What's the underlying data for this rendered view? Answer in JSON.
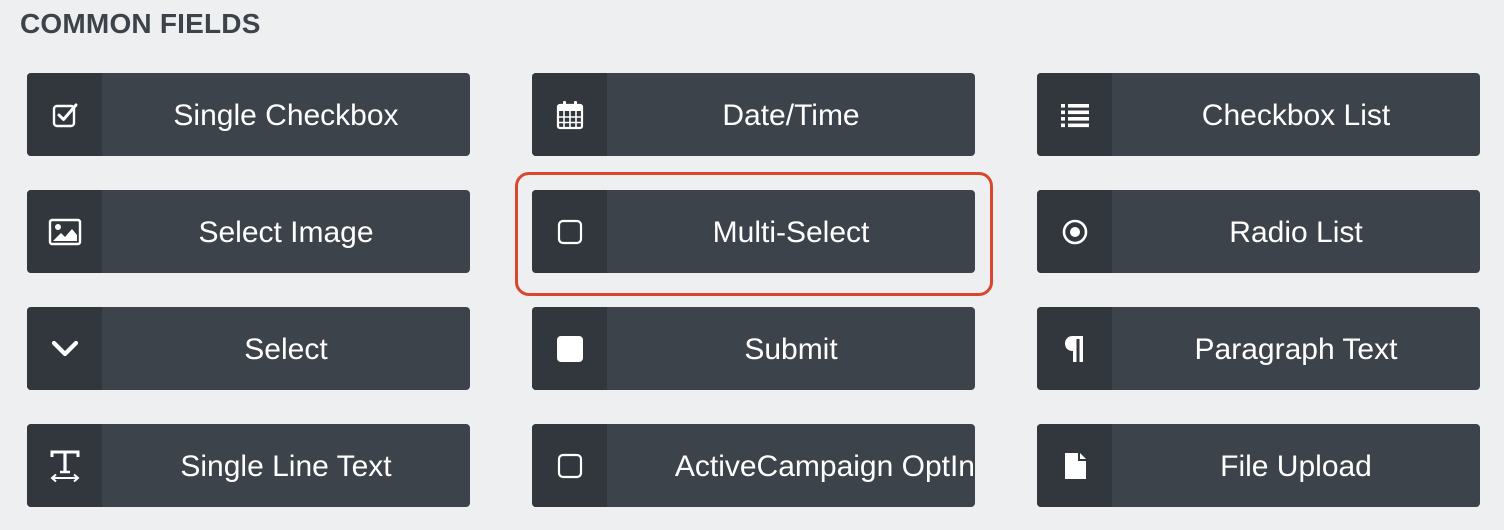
{
  "section": {
    "title": "COMMON FIELDS"
  },
  "fields": [
    {
      "label": "Single Checkbox",
      "icon": "check-square-icon"
    },
    {
      "label": "Date/Time",
      "icon": "calendar-icon"
    },
    {
      "label": "Checkbox List",
      "icon": "list-icon"
    },
    {
      "label": "Select Image",
      "icon": "image-icon"
    },
    {
      "label": "Multi-Select",
      "icon": "square-outline-icon"
    },
    {
      "label": "Radio List",
      "icon": "radio-dot-icon"
    },
    {
      "label": "Select",
      "icon": "chevron-down-icon"
    },
    {
      "label": "Submit",
      "icon": "square-filled-icon"
    },
    {
      "label": "Paragraph Text",
      "icon": "pilcrow-icon"
    },
    {
      "label": "Single Line Text",
      "icon": "text-height-icon"
    },
    {
      "label": "ActiveCampaign OptIn",
      "icon": "square-outline-icon"
    },
    {
      "label": "File Upload",
      "icon": "file-icon"
    }
  ],
  "highlighted_field": "Multi-Select",
  "colors": {
    "button_bg": "#3c434a",
    "icon_bg": "#31373d",
    "highlight": "#d9472e",
    "page_bg": "#eeeff1"
  }
}
